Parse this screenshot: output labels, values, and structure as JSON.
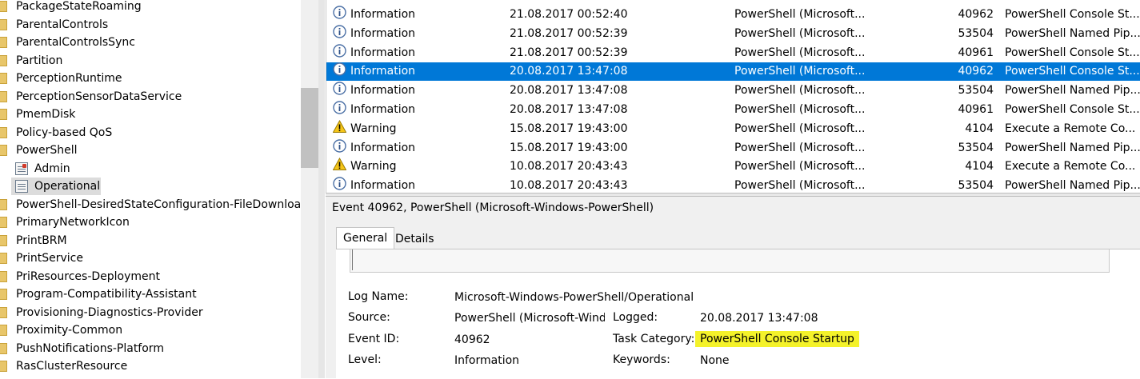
{
  "tree": {
    "items": [
      {
        "label": "PackageStateRoaming",
        "type": "folder"
      },
      {
        "label": "ParentalControls",
        "type": "folder"
      },
      {
        "label": "ParentalControlsSync",
        "type": "folder"
      },
      {
        "label": "Partition",
        "type": "folder"
      },
      {
        "label": "PerceptionRuntime",
        "type": "folder"
      },
      {
        "label": "PerceptionSensorDataService",
        "type": "folder"
      },
      {
        "label": "PmemDisk",
        "type": "folder"
      },
      {
        "label": "Policy-based QoS",
        "type": "folder"
      },
      {
        "label": "PowerShell",
        "type": "folder"
      },
      {
        "label": "Admin",
        "type": "log-admin"
      },
      {
        "label": "Operational",
        "type": "log",
        "selected": true
      },
      {
        "label": "PowerShell-DesiredStateConfiguration-FileDownloadM",
        "type": "folder"
      },
      {
        "label": "PrimaryNetworkIcon",
        "type": "folder"
      },
      {
        "label": "PrintBRM",
        "type": "folder"
      },
      {
        "label": "PrintService",
        "type": "folder"
      },
      {
        "label": "PriResources-Deployment",
        "type": "folder"
      },
      {
        "label": "Program-Compatibility-Assistant",
        "type": "folder"
      },
      {
        "label": "Provisioning-Diagnostics-Provider",
        "type": "folder"
      },
      {
        "label": "Proximity-Common",
        "type": "folder"
      },
      {
        "label": "PushNotifications-Platform",
        "type": "folder"
      },
      {
        "label": "RasClusterResource",
        "type": "folder"
      }
    ]
  },
  "events": {
    "rows": [
      {
        "level": "Information",
        "icon": "info-icon",
        "date": "21.08.2017 00:52:40",
        "source": "PowerShell (Microsoft...",
        "id": "40962",
        "category": "PowerShell Console St..."
      },
      {
        "level": "Information",
        "icon": "info-icon",
        "date": "21.08.2017 00:52:39",
        "source": "PowerShell (Microsoft...",
        "id": "53504",
        "category": "PowerShell Named Pip..."
      },
      {
        "level": "Information",
        "icon": "info-icon",
        "date": "21.08.2017 00:52:39",
        "source": "PowerShell (Microsoft...",
        "id": "40961",
        "category": "PowerShell Console St..."
      },
      {
        "level": "Information",
        "icon": "info-icon",
        "date": "20.08.2017 13:47:08",
        "source": "PowerShell (Microsoft...",
        "id": "40962",
        "category": "PowerShell Console St...",
        "selected": true
      },
      {
        "level": "Information",
        "icon": "info-icon",
        "date": "20.08.2017 13:47:08",
        "source": "PowerShell (Microsoft...",
        "id": "53504",
        "category": "PowerShell Named Pip..."
      },
      {
        "level": "Information",
        "icon": "info-icon",
        "date": "20.08.2017 13:47:08",
        "source": "PowerShell (Microsoft...",
        "id": "40961",
        "category": "PowerShell Console St..."
      },
      {
        "level": "Warning",
        "icon": "warning-icon",
        "date": "15.08.2017 19:43:00",
        "source": "PowerShell (Microsoft...",
        "id": "4104",
        "category": "Execute a Remote Co..."
      },
      {
        "level": "Information",
        "icon": "info-icon",
        "date": "15.08.2017 19:43:00",
        "source": "PowerShell (Microsoft...",
        "id": "53504",
        "category": "PowerShell Named Pip..."
      },
      {
        "level": "Warning",
        "icon": "warning-icon",
        "date": "10.08.2017 20:43:43",
        "source": "PowerShell (Microsoft...",
        "id": "4104",
        "category": "Execute a Remote Co..."
      },
      {
        "level": "Information",
        "icon": "info-icon",
        "date": "10.08.2017 20:43:43",
        "source": "PowerShell (Microsoft...",
        "id": "53504",
        "category": "PowerShell Named Pip..."
      }
    ]
  },
  "detail": {
    "title": "Event 40962, PowerShell (Microsoft-Windows-PowerShell)",
    "tabs": [
      "General",
      "Details"
    ],
    "labels": {
      "log_name": "Log Name:",
      "source": "Source:",
      "event_id": "Event ID:",
      "level": "Level:",
      "logged": "Logged:",
      "task_category": "Task Category:",
      "keywords": "Keywords:"
    },
    "values": {
      "log_name": "Microsoft-Windows-PowerShell/Operational",
      "source": "PowerShell (Microsoft-Windo",
      "event_id": "40962",
      "level": "Information",
      "logged": "20.08.2017 13:47:08",
      "task_category": "PowerShell Console Startup",
      "keywords": "None"
    }
  },
  "colors": {
    "selection": "#0078d7",
    "highlight": "#f4f22a"
  }
}
